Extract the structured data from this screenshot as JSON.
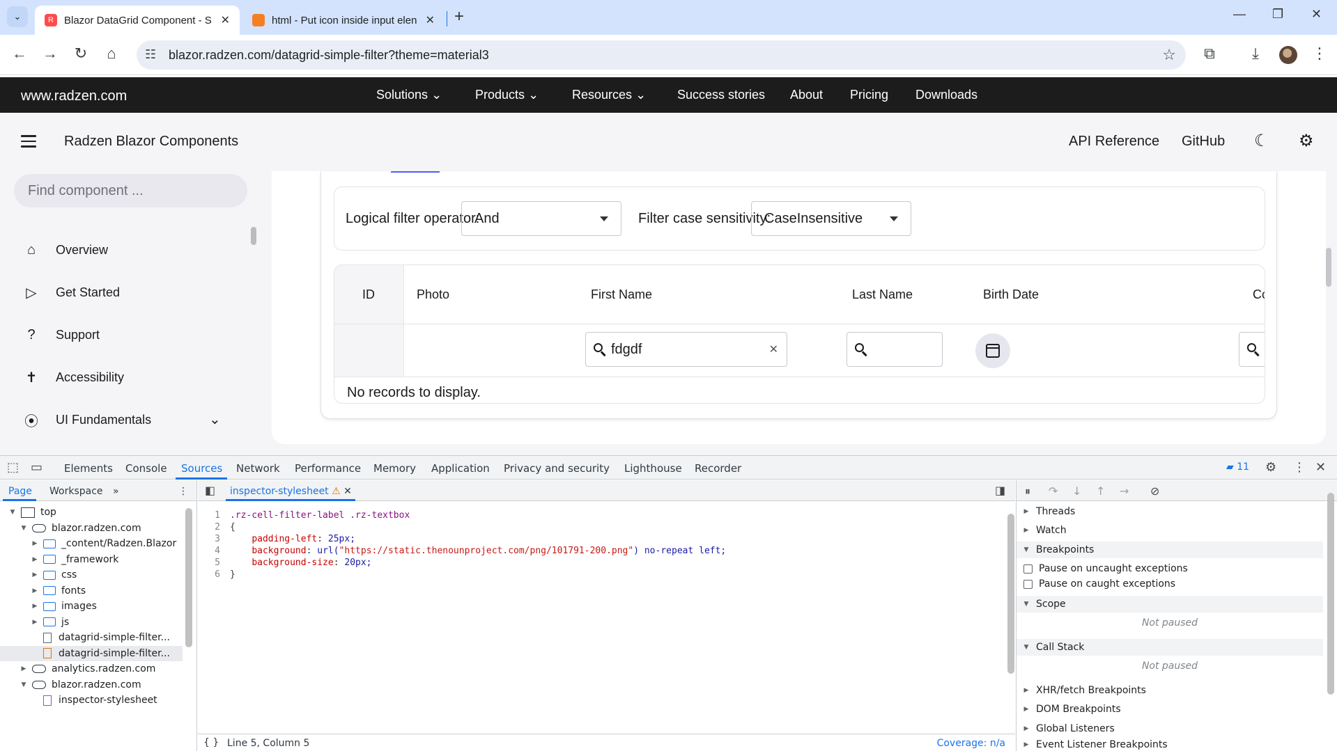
{
  "browser": {
    "tabs": [
      {
        "title": "Blazor DataGrid Component - S",
        "active": true
      },
      {
        "title": "html - Put icon inside input elen",
        "active": false
      }
    ],
    "url": "blazor.radzen.com/datagrid-simple-filter?theme=material3"
  },
  "radzen_nav": {
    "brand": "www.radzen.com",
    "items": [
      "Solutions",
      "Products",
      "Resources",
      "Success stories",
      "About",
      "Pricing",
      "Downloads"
    ]
  },
  "header": {
    "title": "Radzen Blazor Components",
    "api_reference": "API Reference",
    "github": "GitHub"
  },
  "sidebar": {
    "search_placeholder": "Find component ...",
    "items": [
      {
        "label": "Overview",
        "icon": "home-icon"
      },
      {
        "label": "Get Started",
        "icon": "play-circle-icon"
      },
      {
        "label": "Support",
        "icon": "help-icon"
      },
      {
        "label": "Accessibility",
        "icon": "accessibility-icon"
      },
      {
        "label": "UI Fundamentals",
        "icon": "ui-fundamentals-icon"
      }
    ]
  },
  "filter_bar": {
    "logical_label": "Logical filter operator:",
    "logical_value": "And",
    "case_label": "Filter case sensitivity:",
    "case_value": "CaseInsensitive"
  },
  "grid": {
    "columns": [
      "ID",
      "Photo",
      "First Name",
      "Last Name",
      "Birth Date",
      "Co"
    ],
    "first_name_filter": "fdgdf",
    "empty_message": "No records to display."
  },
  "devtools": {
    "tabs": [
      "Elements",
      "Console",
      "Sources",
      "Network",
      "Performance",
      "Memory",
      "Application",
      "Privacy and security",
      "Lighthouse",
      "Recorder"
    ],
    "active_tab": "Sources",
    "issues_count": "11",
    "navigator_tabs": [
      "Page",
      "Workspace"
    ],
    "tree": [
      {
        "label": "top",
        "type": "frame",
        "indent": 0,
        "expanded": true
      },
      {
        "label": "blazor.radzen.com",
        "type": "cloud",
        "indent": 1,
        "expanded": true
      },
      {
        "label": "_content/Radzen.Blazor",
        "type": "folder",
        "indent": 2,
        "expanded": false
      },
      {
        "label": "_framework",
        "type": "folder",
        "indent": 2,
        "expanded": false
      },
      {
        "label": "css",
        "type": "folder",
        "indent": 2,
        "expanded": false
      },
      {
        "label": "fonts",
        "type": "folder",
        "indent": 2,
        "expanded": false
      },
      {
        "label": "images",
        "type": "folder",
        "indent": 2,
        "expanded": false
      },
      {
        "label": "js",
        "type": "folder",
        "indent": 2,
        "expanded": false
      },
      {
        "label": "datagrid-simple-filter...",
        "type": "file",
        "indent": 2
      },
      {
        "label": "datagrid-simple-filter...",
        "type": "file-orange",
        "indent": 2,
        "selected": true
      },
      {
        "label": "analytics.radzen.com",
        "type": "cloud",
        "indent": 1,
        "expanded": false
      },
      {
        "label": "blazor.radzen.com",
        "type": "cloud",
        "indent": 1,
        "expanded": true
      },
      {
        "label": "inspector-stylesheet",
        "type": "file-purple",
        "indent": 2
      }
    ],
    "editor_tab": "inspector-stylesheet",
    "code": [
      ".rz-cell-filter-label .rz-textbox",
      "{",
      "    padding-left: 25px;",
      "    background: url(\"https://static.thenounproject.com/png/101791-200.png\") no-repeat left;",
      "    background-size: 20px;",
      "}"
    ],
    "status_position": "Line 5, Column 5",
    "coverage": "Coverage: n/a",
    "debugger": {
      "threads": "Threads",
      "watch": "Watch",
      "breakpoints": "Breakpoints",
      "pause_uncaught": "Pause on uncaught exceptions",
      "pause_caught": "Pause on caught exceptions",
      "scope": "Scope",
      "not_paused": "Not paused",
      "call_stack": "Call Stack",
      "xhr": "XHR/fetch Breakpoints",
      "dom": "DOM Breakpoints",
      "global": "Global Listeners",
      "event": "Event Listener Breakpoints"
    }
  }
}
